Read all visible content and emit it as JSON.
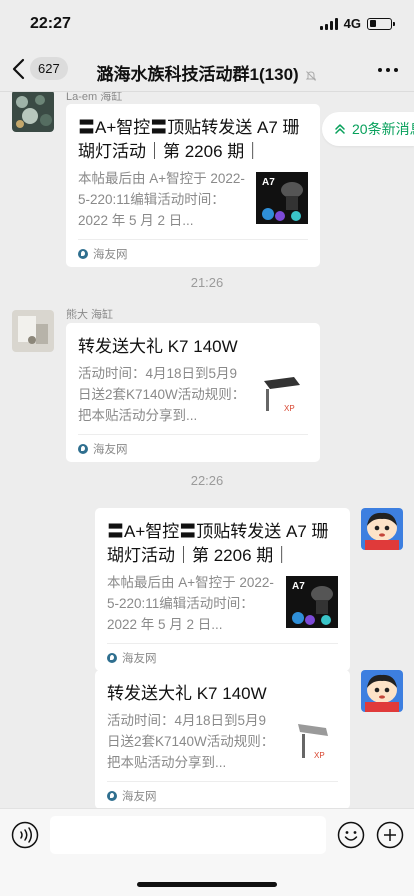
{
  "status_bar": {
    "time": "22:27",
    "network": "4G",
    "battery_level": 0.3
  },
  "nav": {
    "unread_count": "627",
    "title": "潞海水族科技活动群1(130)"
  },
  "new_messages": {
    "label": "20条新消息"
  },
  "messages": [
    {
      "sender": "La-em 海缸",
      "title": "〓A+智控〓顶贴转发送 A7 珊瑚灯活动｜第 2206 期｜",
      "desc": "本帖最后由 A+智控于 2022-5-220:11编辑活动时间：2022 年 5 月 2 日...",
      "source": "海友网"
    },
    {
      "sender": "熊大 海缸",
      "title": "转发送大礼 K7 140W",
      "desc": "活动时间：4月18日到5月9日送2套K7140W活动规则：把本贴活动分享到...",
      "source": "海友网"
    },
    {
      "title": "〓A+智控〓顶贴转发送 A7 珊瑚灯活动｜第 2206 期｜",
      "desc": "本帖最后由 A+智控于 2022-5-220:11编辑活动时间：2022 年 5 月 2 日...",
      "source": "海友网"
    },
    {
      "title": "转发送大礼 K7 140W",
      "desc": "活动时间：4月18日到5月9日送2套K7140W活动规则：把本贴活动分享到...",
      "source": "海友网"
    }
  ],
  "timestamps": [
    "21:26",
    "22:26"
  ],
  "thumb_text": {
    "a7": "A7",
    "k7": "XP"
  },
  "colors": {
    "accent_green": "#07a05b",
    "chat_bg": "#ededed",
    "card_bg": "#ffffff"
  }
}
